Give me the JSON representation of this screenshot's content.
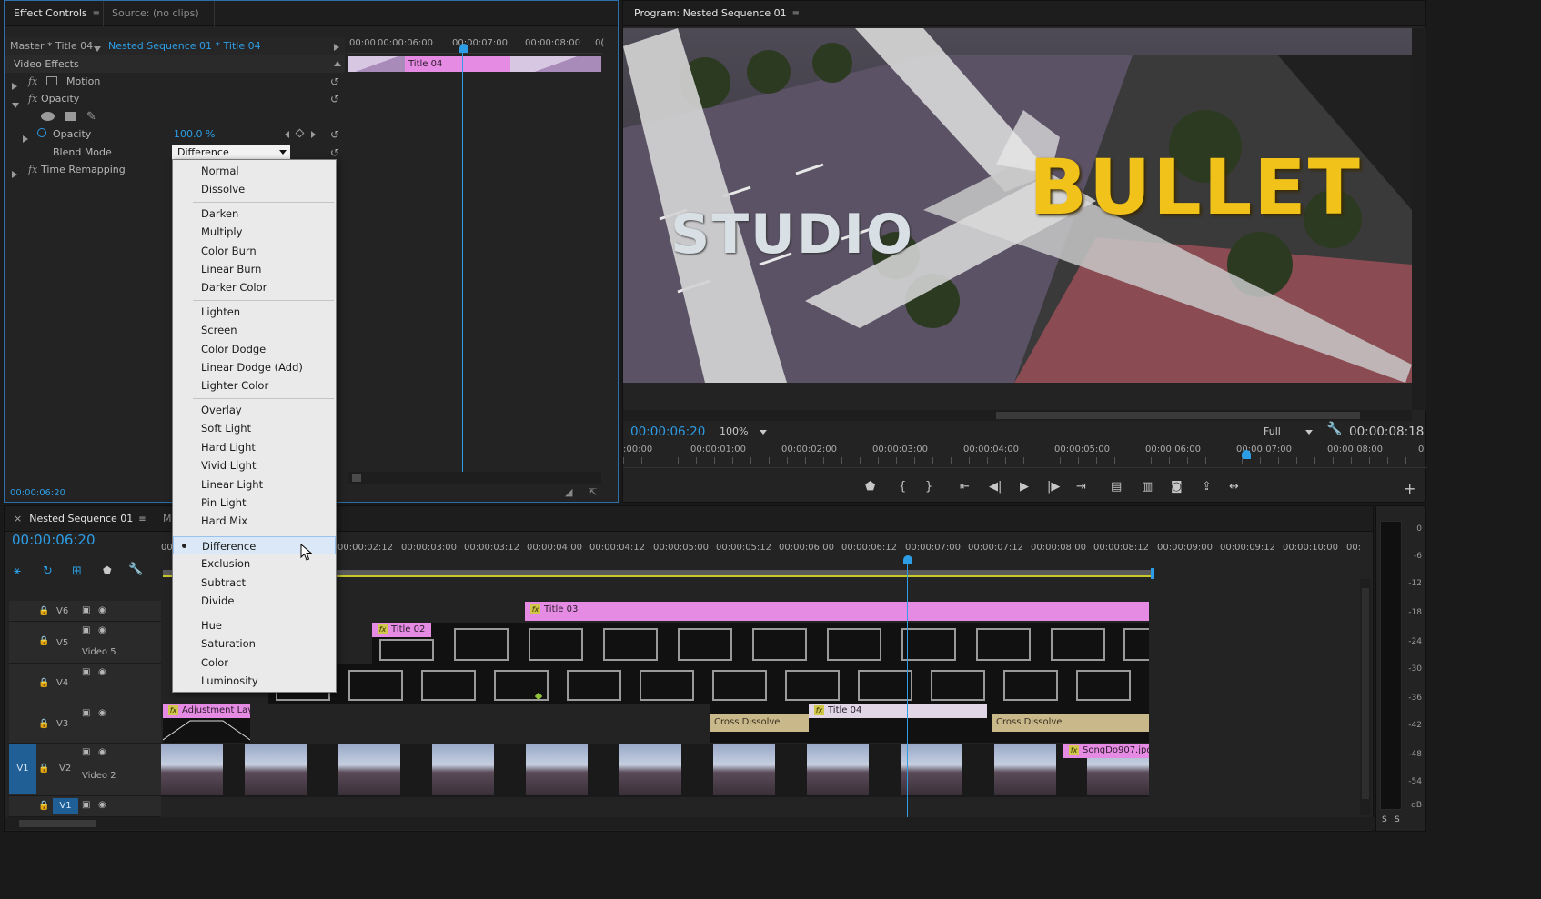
{
  "effect_controls": {
    "tab_title": "Effect Controls",
    "source_tab": "Source: (no clips)",
    "master_label": "Master * Title 04",
    "clip_label": "Nested Sequence 01 * Title 04",
    "ruler": [
      "00:00",
      "00:00:06:00",
      "00:00:07:00",
      "00:00:08:00",
      "0("
    ],
    "clip_name": "Title 04",
    "section_title": "Video Effects",
    "rows": {
      "motion": "Motion",
      "opacity_group": "Opacity",
      "opacity_param": "Opacity",
      "opacity_value": "100.0 %",
      "blend_mode": "Blend Mode",
      "blend_value": "Difference",
      "time_remapping": "Time Remapping"
    },
    "timecode": "00:00:06:20"
  },
  "blend_menu": {
    "groups": [
      [
        "Normal",
        "Dissolve"
      ],
      [
        "Darken",
        "Multiply",
        "Color Burn",
        "Linear Burn",
        "Darker Color"
      ],
      [
        "Lighten",
        "Screen",
        "Color Dodge",
        "Linear Dodge (Add)",
        "Lighter Color"
      ],
      [
        "Overlay",
        "Soft Light",
        "Hard Light",
        "Vivid Light",
        "Linear Light",
        "Pin Light",
        "Hard Mix"
      ],
      [
        "Difference",
        "Exclusion",
        "Subtract",
        "Divide"
      ],
      [
        "Hue",
        "Saturation",
        "Color",
        "Luminosity"
      ]
    ],
    "selected": "Difference"
  },
  "program": {
    "title": "Program: Nested Sequence 01",
    "overlay_left": "STUDIO",
    "overlay_right": "BULLET",
    "timecode": "00:00:06:20",
    "zoom": "100%",
    "resolution": "Full",
    "duration": "00:00:08:18",
    "ruler": [
      ":00:00",
      "00:00:01:00",
      "00:00:02:00",
      "00:00:03:00",
      "00:00:04:00",
      "00:00:05:00",
      "00:00:06:00",
      "00:00:07:00",
      "00:00:08:00",
      "0"
    ]
  },
  "timeline": {
    "tab_title": "Nested Sequence 01",
    "tab2": "Ma",
    "timecode": "00:00:06:20",
    "ruler": [
      "00:00:02:12",
      "00:00:03:00",
      "00:00:03:12",
      "00:00:04:00",
      "00:00:04:12",
      "00:00:05:00",
      "00:00:05:12",
      "00:00:06:00",
      "00:00:06:12",
      "00:00:07:00",
      "00:00:07:12",
      "00:00:08:00",
      "00:00:08:12",
      "00:00:09:00",
      "00:00:09:12",
      "00:00:10:00",
      "00:"
    ],
    "ruler_start": "00",
    "tracks": {
      "v6": "V6",
      "v5": "V5",
      "v5_name": "Video 5",
      "v4": "V4",
      "v3": "V3",
      "v2": "V2",
      "v2_name": "Video 2",
      "v1": "V1",
      "src_v1": "V1"
    },
    "clips": {
      "title03": "Title 03",
      "title02": "Title 02",
      "adjustment": "Adjustment Lay",
      "title04": "Title 04",
      "cross1": "Cross Dissolve",
      "cross2": "Cross Dissolve",
      "songdo": "SongDo907.jpg"
    },
    "fx_badge": "fx"
  },
  "meter": {
    "labels": [
      "0",
      "-6",
      "-12",
      "-18",
      "-24",
      "-30",
      "-36",
      "-42",
      "-48",
      "-54",
      "dB"
    ],
    "solo": [
      "S",
      "S"
    ]
  },
  "colors": {
    "accent": "#2d9de6",
    "title_clip": "#e58be3",
    "panel": "#232323"
  }
}
